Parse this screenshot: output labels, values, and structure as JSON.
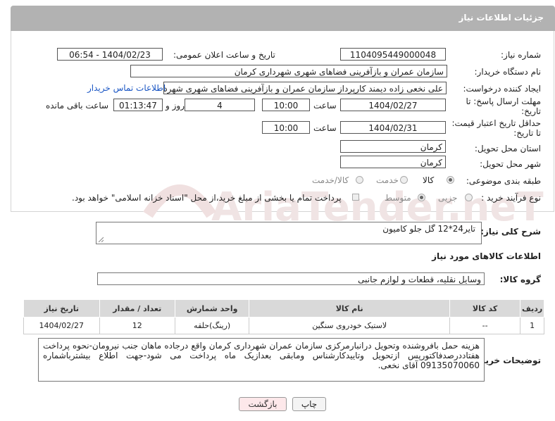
{
  "header": {
    "title": "جزئیات اطلاعات نیاز"
  },
  "form": {
    "need_number_label": "شماره نیاز:",
    "need_number": "1104095449000048",
    "announce_label": "تاریخ و ساعت اعلان عمومی:",
    "announce_value": "1404/02/23 - 06:54",
    "buyer_org_label": "نام دستگاه خریدار:",
    "buyer_org": "سازمان عمران و بازآفرینی فضاهای شهری شهرداری کرمان",
    "requester_label": "ایجاد کننده درخواست:",
    "requester": "علی نخعی زاده دیمند کارپرداز سازمان عمران و بازآفرینی فضاهای شهری شهرداری کرمان",
    "contact_link": "اطلاعات تماس خریدار",
    "deadline_label_1": "مهلت ارسال پاسخ: تا",
    "deadline_label_2": "تاریخ:",
    "deadline_date": "1404/02/27",
    "time_label": "ساعت",
    "deadline_time": "10:00",
    "days_value": "4",
    "days_label": "روز و",
    "remaining_value": "01:13:47",
    "remaining_label": "ساعت باقی مانده",
    "price_label_1": "حداقل تاریخ اعتبار قیمت:",
    "price_label_2": "تا تاریخ:",
    "price_date": "1404/02/31",
    "price_time": "10:00",
    "province_label": "استان محل تحویل:",
    "province": "کرمان",
    "city_label": "شهر محل تحویل:",
    "city": "کرمان",
    "category_label": "طبقه بندی موضوعی:",
    "category_options": [
      "کالا",
      "خدمت",
      "کالا/خدمت"
    ],
    "category_selected": "کالا",
    "process_label": "نوع فرآیند خرید :",
    "process_options": [
      "جزیی",
      "متوسط"
    ],
    "process_selected": "متوسط",
    "payment_note": "پرداخت تمام یا بخشی از مبلغ خرید،از محل \"اسناد خزانه اسلامی\" خواهد بود."
  },
  "description": {
    "label": "شرح کلی نیاز:",
    "value": "تایر24*12 گل جلو کامیون"
  },
  "goods": {
    "section_title": "اطلاعات کالاهای مورد نیاز",
    "group_label": "گروه کالا:",
    "group_value": "وسایل نقلیه، قطعات و لوازم جانبی",
    "columns": [
      "ردیف",
      "کد کالا",
      "نام کالا",
      "واحد شمارش",
      "تعداد / مقدار",
      "تاریخ نیاز"
    ],
    "rows": [
      {
        "row": "1",
        "code": "--",
        "name": "لاستیک خودروی سنگین",
        "unit": "(رینگ)حلقه",
        "qty": "12",
        "date": "1404/02/27"
      }
    ]
  },
  "buyer_notes": {
    "label": "توضیحات خریدار:",
    "value": "هزینه حمل بافروشنده وتحویل درانبارمرکزی سازمان عمران شهرداری کرمان واقع درجاده ماهان جنب نیرومان-نحوه پرداخت هفتاددرصدفاکتورپس ازتحویل وتاییدکارشناس ومابقی بعدازیک ماه پرداخت می شود-جهت اطلاع بیشترباشماره 09135070060 آقای نخعی."
  },
  "buttons": {
    "print": "چاپ",
    "back": "بازگشت"
  },
  "watermark": {
    "text": "AriaTender.neT"
  },
  "colors": {
    "header_bg": "#b2b2b2",
    "link": "#1a56c4",
    "back_button_bg": "#fde8ea"
  }
}
